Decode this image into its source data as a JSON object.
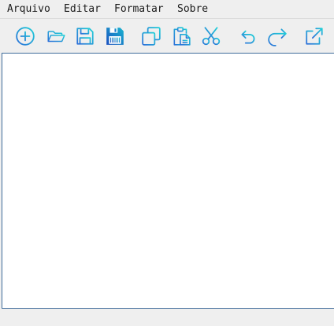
{
  "menubar": {
    "items": [
      {
        "label": "Arquivo"
      },
      {
        "label": "Editar"
      },
      {
        "label": "Formatar"
      },
      {
        "label": "Sobre"
      }
    ]
  },
  "toolbar": {
    "buttons": [
      {
        "icon": "new-file-icon"
      },
      {
        "icon": "open-folder-icon"
      },
      {
        "icon": "save-icon"
      },
      {
        "icon": "save-as-icon"
      },
      {
        "icon": "copy-icon"
      },
      {
        "icon": "paste-icon"
      },
      {
        "icon": "cut-icon"
      },
      {
        "icon": "undo-icon"
      },
      {
        "icon": "redo-icon"
      },
      {
        "icon": "external-link-icon"
      }
    ]
  },
  "editor": {
    "content": ""
  },
  "colors": {
    "icon_cyan": "#1fc6da",
    "icon_blue": "#2b6ed9",
    "editor_border": "#3f6c9b",
    "background": "#efefef"
  }
}
